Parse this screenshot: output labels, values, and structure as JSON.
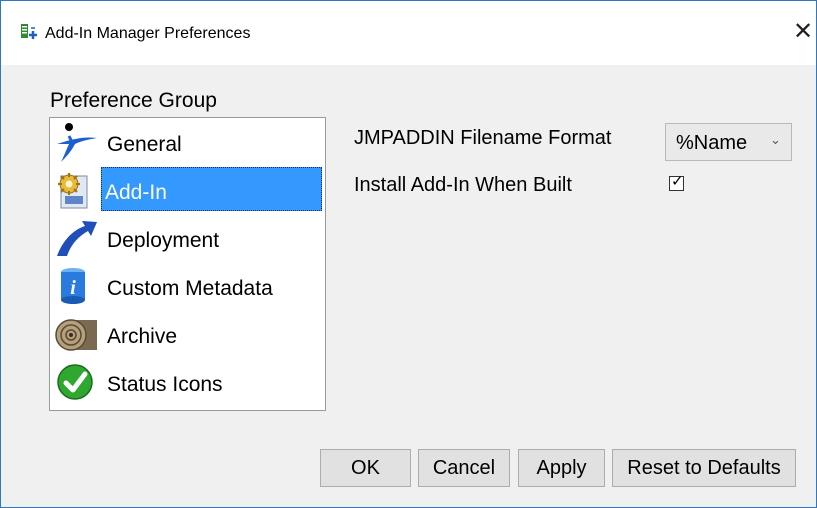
{
  "window": {
    "title": "Add-In Manager Preferences",
    "close_glyph": "✕"
  },
  "preference_group": {
    "label": "Preference Group",
    "items": [
      {
        "label": "General",
        "icon": "general-icon",
        "selected": false
      },
      {
        "label": "Add-In",
        "icon": "add-in-icon",
        "selected": true
      },
      {
        "label": "Deployment",
        "icon": "deployment-icon",
        "selected": false
      },
      {
        "label": "Custom Metadata",
        "icon": "custom-metadata-icon",
        "selected": false
      },
      {
        "label": "Archive",
        "icon": "archive-icon",
        "selected": false
      },
      {
        "label": "Status Icons",
        "icon": "status-icons-icon",
        "selected": false
      }
    ]
  },
  "settings": {
    "filename_format_label": "JMPADDIN Filename Format",
    "filename_format_value": "%Name",
    "install_label": "Install Add-In When Built",
    "install_checked": true,
    "check_glyph": "✓"
  },
  "buttons": {
    "ok": "OK",
    "cancel": "Cancel",
    "apply": "Apply",
    "reset": "Reset to Defaults"
  },
  "colors": {
    "selection": "#3399ff",
    "window_border": "#2b79c2"
  }
}
